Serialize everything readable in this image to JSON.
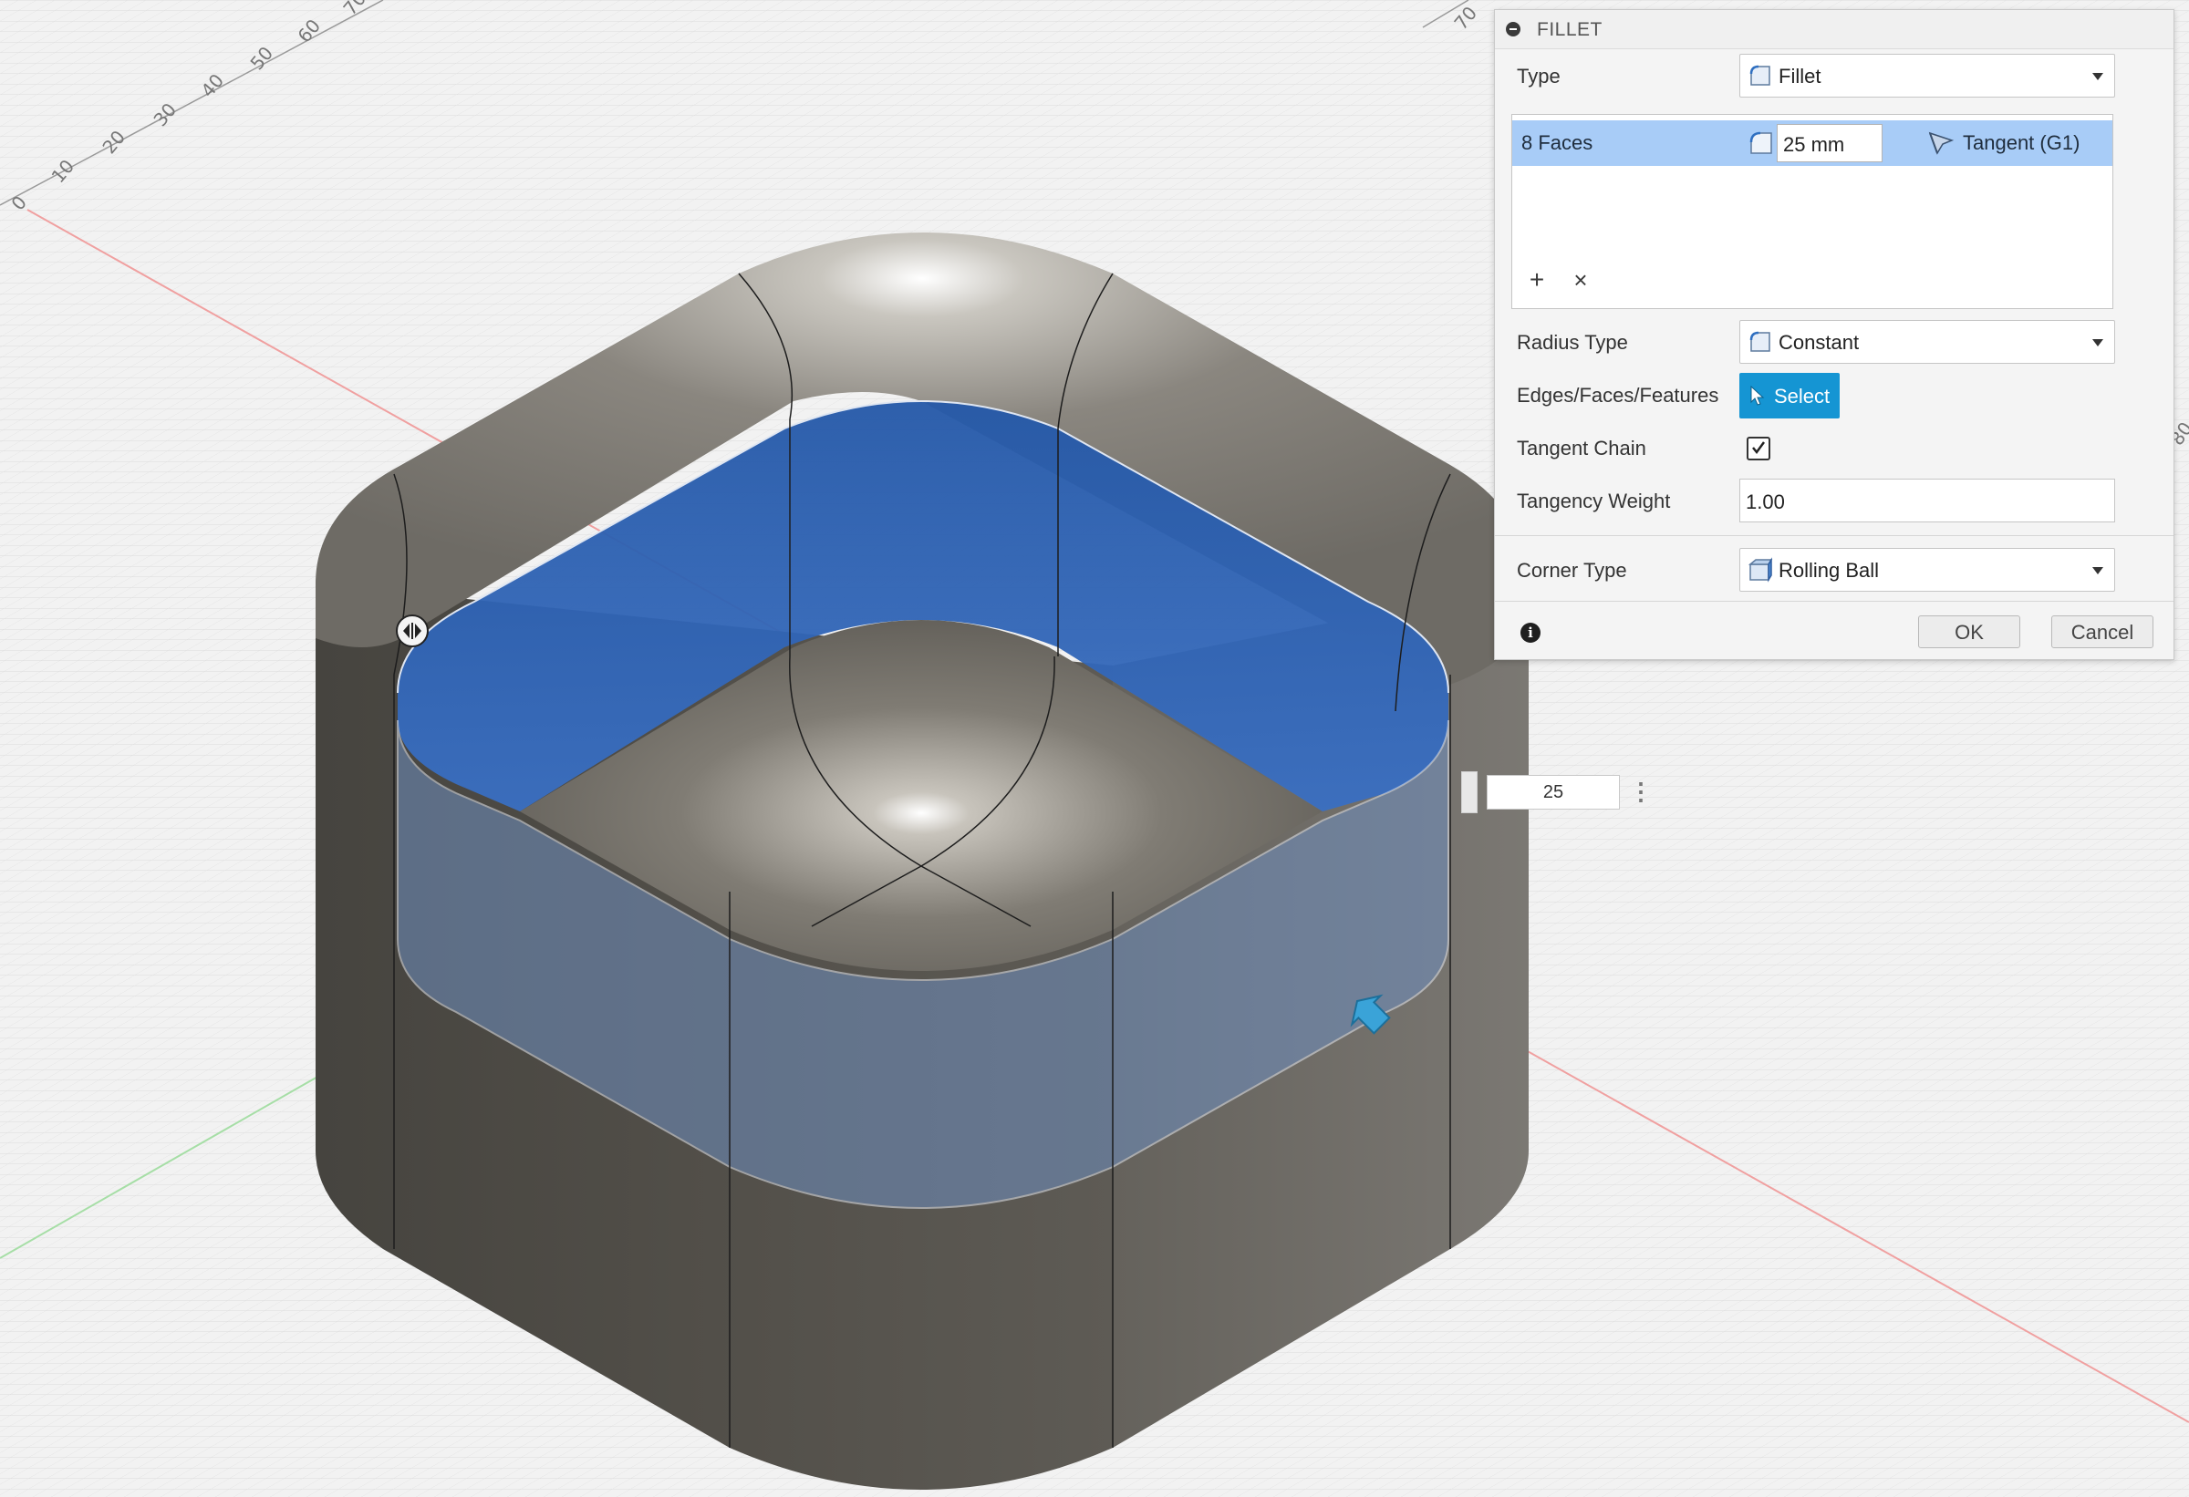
{
  "viewport": {
    "ruler_ticks": [
      "0",
      "10",
      "20",
      "30",
      "40",
      "50",
      "60",
      "70"
    ],
    "ruler_top_right": "70",
    "ruler_right_edge": "80",
    "radius_manipulator_value": "25",
    "colors": {
      "selection_blue": "#2f66b8",
      "body_grey": "#5b5a55",
      "grid": "#dedede",
      "background": "#f2f2f2"
    }
  },
  "dialog": {
    "title": "FILLET",
    "type_label": "Type",
    "type_value": "Fillet",
    "selection": {
      "faces": "8 Faces",
      "radius": "25 mm",
      "continuity": "Tangent (G1)"
    },
    "add_icon": "plus-icon",
    "remove_icon": "close-icon",
    "radius_type_label": "Radius Type",
    "radius_type_value": "Constant",
    "edges_label": "Edges/Faces/Features",
    "select_button": "Select",
    "tangent_chain_label": "Tangent Chain",
    "tangent_chain_checked": true,
    "tangency_weight_label": "Tangency Weight",
    "tangency_weight_value": "1.00",
    "corner_type_label": "Corner Type",
    "corner_type_value": "Rolling Ball",
    "ok_button": "OK",
    "cancel_button": "Cancel",
    "accent_color": "#1595d3",
    "selected_row_color": "#a8ccf7"
  }
}
